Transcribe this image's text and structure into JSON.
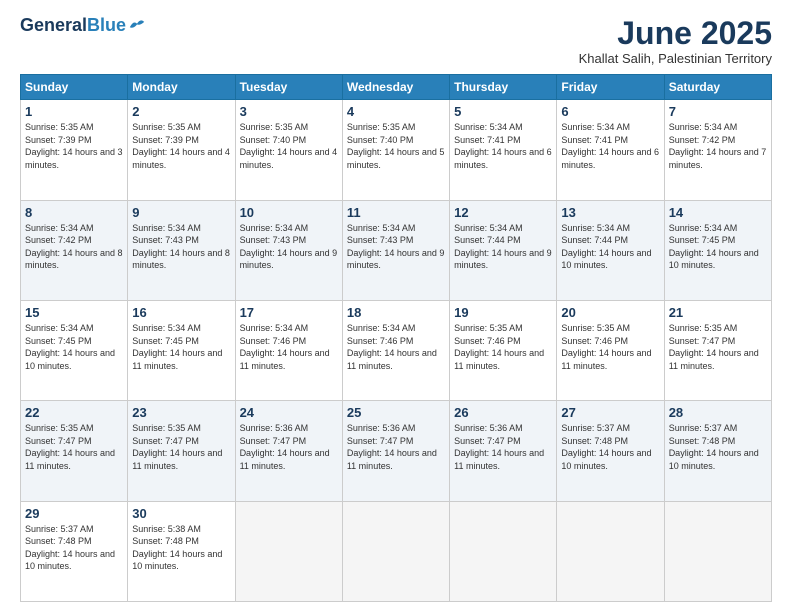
{
  "logo": {
    "general": "General",
    "blue": "Blue"
  },
  "title": {
    "month": "June 2025",
    "location": "Khallat Salih, Palestinian Territory"
  },
  "headers": [
    "Sunday",
    "Monday",
    "Tuesday",
    "Wednesday",
    "Thursday",
    "Friday",
    "Saturday"
  ],
  "weeks": [
    [
      {
        "day": "1",
        "sunrise": "5:35 AM",
        "sunset": "7:39 PM",
        "daylight": "14 hours and 3 minutes."
      },
      {
        "day": "2",
        "sunrise": "5:35 AM",
        "sunset": "7:39 PM",
        "daylight": "14 hours and 4 minutes."
      },
      {
        "day": "3",
        "sunrise": "5:35 AM",
        "sunset": "7:40 PM",
        "daylight": "14 hours and 4 minutes."
      },
      {
        "day": "4",
        "sunrise": "5:35 AM",
        "sunset": "7:40 PM",
        "daylight": "14 hours and 5 minutes."
      },
      {
        "day": "5",
        "sunrise": "5:34 AM",
        "sunset": "7:41 PM",
        "daylight": "14 hours and 6 minutes."
      },
      {
        "day": "6",
        "sunrise": "5:34 AM",
        "sunset": "7:41 PM",
        "daylight": "14 hours and 6 minutes."
      },
      {
        "day": "7",
        "sunrise": "5:34 AM",
        "sunset": "7:42 PM",
        "daylight": "14 hours and 7 minutes."
      }
    ],
    [
      {
        "day": "8",
        "sunrise": "5:34 AM",
        "sunset": "7:42 PM",
        "daylight": "14 hours and 8 minutes."
      },
      {
        "day": "9",
        "sunrise": "5:34 AM",
        "sunset": "7:43 PM",
        "daylight": "14 hours and 8 minutes."
      },
      {
        "day": "10",
        "sunrise": "5:34 AM",
        "sunset": "7:43 PM",
        "daylight": "14 hours and 9 minutes."
      },
      {
        "day": "11",
        "sunrise": "5:34 AM",
        "sunset": "7:43 PM",
        "daylight": "14 hours and 9 minutes."
      },
      {
        "day": "12",
        "sunrise": "5:34 AM",
        "sunset": "7:44 PM",
        "daylight": "14 hours and 9 minutes."
      },
      {
        "day": "13",
        "sunrise": "5:34 AM",
        "sunset": "7:44 PM",
        "daylight": "14 hours and 10 minutes."
      },
      {
        "day": "14",
        "sunrise": "5:34 AM",
        "sunset": "7:45 PM",
        "daylight": "14 hours and 10 minutes."
      }
    ],
    [
      {
        "day": "15",
        "sunrise": "5:34 AM",
        "sunset": "7:45 PM",
        "daylight": "14 hours and 10 minutes."
      },
      {
        "day": "16",
        "sunrise": "5:34 AM",
        "sunset": "7:45 PM",
        "daylight": "14 hours and 11 minutes."
      },
      {
        "day": "17",
        "sunrise": "5:34 AM",
        "sunset": "7:46 PM",
        "daylight": "14 hours and 11 minutes."
      },
      {
        "day": "18",
        "sunrise": "5:34 AM",
        "sunset": "7:46 PM",
        "daylight": "14 hours and 11 minutes."
      },
      {
        "day": "19",
        "sunrise": "5:35 AM",
        "sunset": "7:46 PM",
        "daylight": "14 hours and 11 minutes."
      },
      {
        "day": "20",
        "sunrise": "5:35 AM",
        "sunset": "7:46 PM",
        "daylight": "14 hours and 11 minutes."
      },
      {
        "day": "21",
        "sunrise": "5:35 AM",
        "sunset": "7:47 PM",
        "daylight": "14 hours and 11 minutes."
      }
    ],
    [
      {
        "day": "22",
        "sunrise": "5:35 AM",
        "sunset": "7:47 PM",
        "daylight": "14 hours and 11 minutes."
      },
      {
        "day": "23",
        "sunrise": "5:35 AM",
        "sunset": "7:47 PM",
        "daylight": "14 hours and 11 minutes."
      },
      {
        "day": "24",
        "sunrise": "5:36 AM",
        "sunset": "7:47 PM",
        "daylight": "14 hours and 11 minutes."
      },
      {
        "day": "25",
        "sunrise": "5:36 AM",
        "sunset": "7:47 PM",
        "daylight": "14 hours and 11 minutes."
      },
      {
        "day": "26",
        "sunrise": "5:36 AM",
        "sunset": "7:47 PM",
        "daylight": "14 hours and 11 minutes."
      },
      {
        "day": "27",
        "sunrise": "5:37 AM",
        "sunset": "7:48 PM",
        "daylight": "14 hours and 10 minutes."
      },
      {
        "day": "28",
        "sunrise": "5:37 AM",
        "sunset": "7:48 PM",
        "daylight": "14 hours and 10 minutes."
      }
    ],
    [
      {
        "day": "29",
        "sunrise": "5:37 AM",
        "sunset": "7:48 PM",
        "daylight": "14 hours and 10 minutes."
      },
      {
        "day": "30",
        "sunrise": "5:38 AM",
        "sunset": "7:48 PM",
        "daylight": "14 hours and 10 minutes."
      },
      null,
      null,
      null,
      null,
      null
    ]
  ],
  "labels": {
    "sunrise": "Sunrise:",
    "sunset": "Sunset:",
    "daylight": "Daylight:"
  }
}
